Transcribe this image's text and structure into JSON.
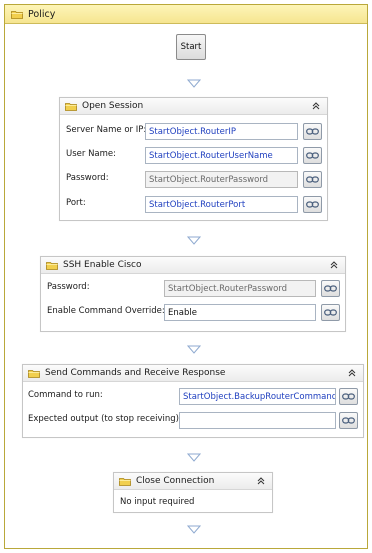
{
  "policy": {
    "title": "Policy"
  },
  "start": {
    "label": "Start"
  },
  "open_session": {
    "title": "Open Session",
    "fields": [
      {
        "label": "Server Name or IP:",
        "value": "StartObject.RouterIP",
        "state": "blue"
      },
      {
        "label": "User Name:",
        "value": "StartObject.RouterUserName",
        "state": "blue"
      },
      {
        "label": "Password:",
        "value": "StartObject.RouterPassword",
        "state": "disabled"
      },
      {
        "label": "Port:",
        "value": "StartObject.RouterPort",
        "state": "blue"
      }
    ]
  },
  "ssh_enable": {
    "title": "SSH Enable Cisco",
    "fields": [
      {
        "label": "Password:",
        "value": "StartObject.RouterPassword",
        "state": "disabled"
      },
      {
        "label": "Enable Command Override:",
        "value": "Enable",
        "state": "dark"
      }
    ]
  },
  "send_commands": {
    "title": "Send Commands and Receive Response",
    "fields": [
      {
        "label": "Command to run:",
        "value": "StartObject.BackupRouterCommand",
        "state": "blue"
      },
      {
        "label": "Expected output (to stop receiving):",
        "value": "",
        "state": "dark"
      }
    ]
  },
  "close_connection": {
    "title": "Close Connection",
    "body": "No input required"
  },
  "icons": {
    "folder": "folder-icon",
    "collapse": "collapse-chevron-icon",
    "link": "chain-link-icon",
    "connector": "down-triangle-icon"
  },
  "colors": {
    "policy_header": "#f6e590",
    "value_blue": "#1f3fbf"
  }
}
